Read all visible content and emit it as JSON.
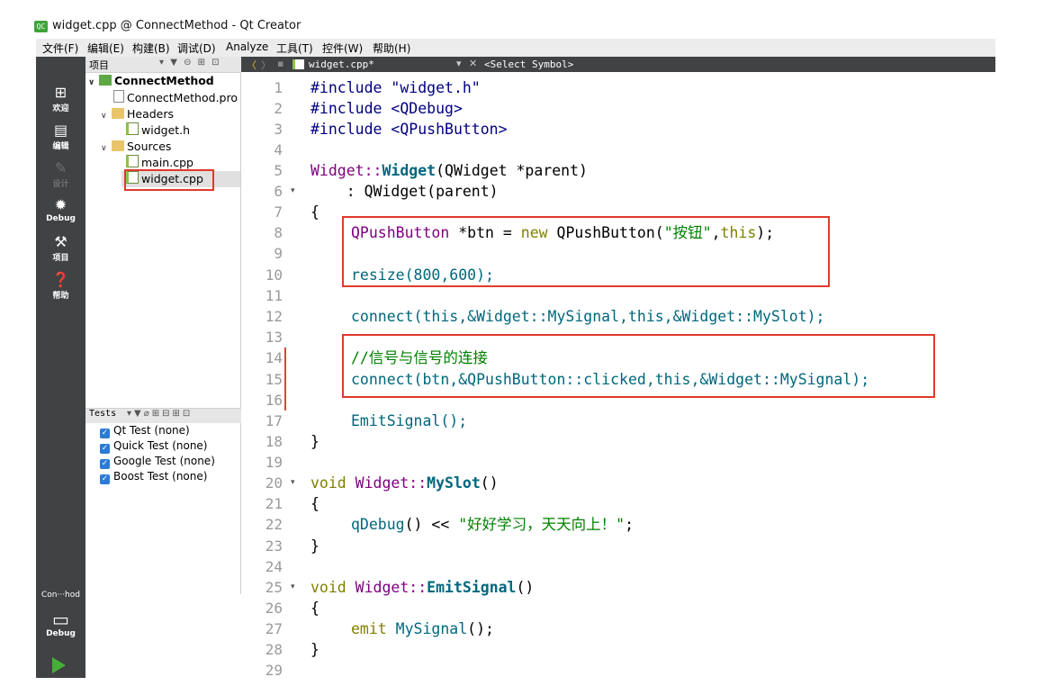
{
  "window": {
    "title": "widget.cpp @ ConnectMethod - Qt Creator",
    "app_icon": "QC"
  },
  "menu": [
    "文件(F)",
    "编辑(E)",
    "构建(B)",
    "调试(D)",
    "Analyze",
    "工具(T)",
    "控件(W)",
    "帮助(H)"
  ],
  "modes": [
    {
      "label": "欢迎",
      "icon": "grid-icon"
    },
    {
      "label": "编辑",
      "icon": "edit-icon"
    },
    {
      "label": "设计",
      "icon": "pencil-icon"
    },
    {
      "label": "Debug",
      "icon": "bug-icon"
    },
    {
      "label": "项目",
      "icon": "wrench-icon"
    },
    {
      "label": "帮助",
      "icon": "help-icon"
    }
  ],
  "project_pane": {
    "title": "项目",
    "tree": {
      "project": "ConnectMethod",
      "pro_file": "ConnectMethod.pro",
      "headers_label": "Headers",
      "header_files": [
        "widget.h"
      ],
      "sources_label": "Sources",
      "source_files": [
        "main.cpp",
        "widget.cpp"
      ]
    }
  },
  "tests_pane": {
    "title": "Tests",
    "items": [
      "Qt Test (none)",
      "Quick Test (none)",
      "Google Test (none)",
      "Boost Test (none)"
    ]
  },
  "target": {
    "name": "Con···hod",
    "mode": "Debug"
  },
  "editor": {
    "filename": "widget.cpp*",
    "symbol": "<Select Symbol>",
    "lines": [
      "1",
      "2",
      "3",
      "4",
      "5",
      "6",
      "7",
      "8",
      "9",
      "10",
      "11",
      "12",
      "13",
      "14",
      "15",
      "16",
      "17",
      "18",
      "19",
      "20",
      "21",
      "22",
      "23",
      "24",
      "25",
      "26",
      "27",
      "28",
      "29"
    ],
    "code": {
      "l1": "#include \"widget.h\"",
      "l2": "#include <QDebug>",
      "l3": "#include <QPushButton>",
      "l5_class": "Widget::",
      "l5_ctor": "Widget",
      "l5_rest": "(QWidget *parent)",
      "l6": "    : QWidget(parent)",
      "l8_type": "QPushButton",
      "l8_mid": " *btn = ",
      "l8_new": "new",
      "l8_ctor": " QPushButton(",
      "l8_str": "\"按钮\"",
      "l8_comma": ",",
      "l8_this": "this",
      "l8_end": ");",
      "l10": "resize(800,600);",
      "l12": "connect(this,&Widget::MySignal,this,&Widget::MySlot);",
      "l14": "//信号与信号的连接",
      "l15": "connect(btn,&QPushButton::clicked,this,&Widget::MySignal);",
      "l17": "EmitSignal();",
      "l20_void": "void",
      "l20_cls": " Widget::",
      "l20_fn": "MySlot",
      "l20_end": "()",
      "l22_fn": "qDebug",
      "l22_mid": "() << ",
      "l22_str": "\"好好学习，天天向上！\"",
      "l22_end": ";",
      "l25_void": "void",
      "l25_cls": " Widget::",
      "l25_fn": "EmitSignal",
      "l25_end": "()",
      "l27_kw": "emit",
      "l27_fn": " MySignal",
      "l27_end": "();"
    }
  }
}
